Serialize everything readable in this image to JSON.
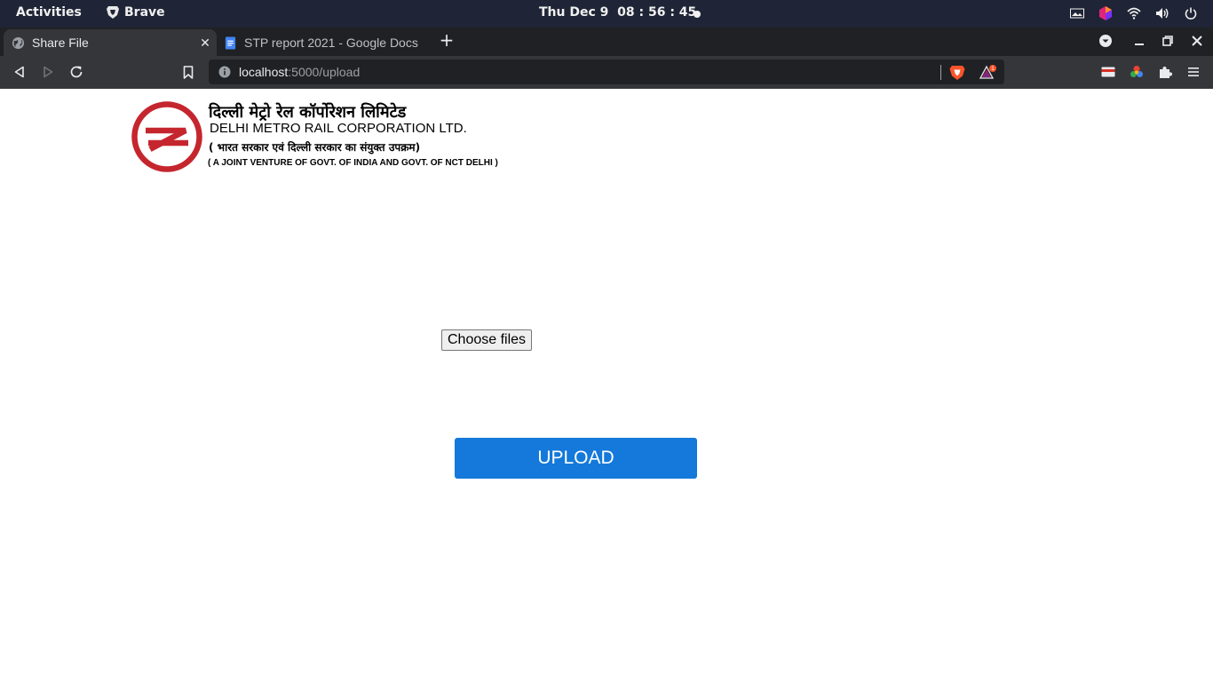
{
  "system_bar": {
    "activities": "Activities",
    "app_name": "Brave",
    "clock": "Thu Dec 9  08 : 56 : 45"
  },
  "browser": {
    "tabs": [
      {
        "title": "Share File",
        "active": true
      },
      {
        "title": "STP report 2021 - Google Docs",
        "active": false
      }
    ],
    "url_host": "localhost",
    "url_path": ":5000/upload",
    "rewards_badge": "1"
  },
  "page": {
    "org_name_hindi": "दिल्ली मेट्रो रेल कॉर्पोरेशन  लिमिटेड",
    "org_name_english": "DELHI METRO RAIL CORPORATION LTD.",
    "org_subtitle_hindi": "( भारत सरकार एवं दिल्ली सरकार का संयुक्त उपक्रम)",
    "org_subtitle_english": "( A JOINT VENTURE OF GOVT. OF INDIA AND GOVT. OF NCT DELHI )",
    "choose_files_label": "Choose files",
    "upload_label": "UPLOAD"
  },
  "colors": {
    "topbar": "#1f2536",
    "tabstrip": "#202124",
    "toolbar": "#35363a",
    "logo_red": "#c5262e",
    "upload_button": "#1479da"
  }
}
